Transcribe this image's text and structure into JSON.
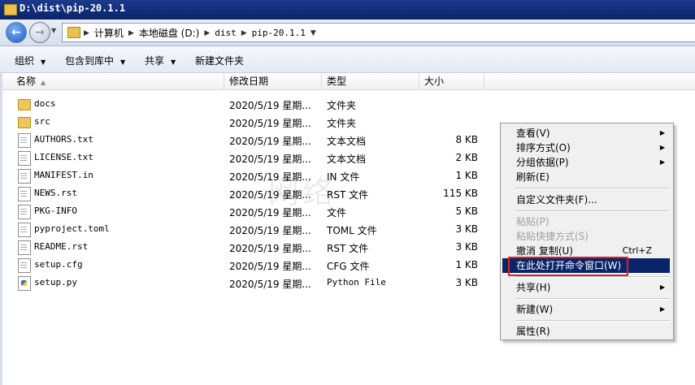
{
  "window": {
    "title": "D:\\dist\\pip-20.1.1"
  },
  "address": {
    "crumbs": [
      "计算机",
      "本地磁盘 (D:)",
      "dist",
      "pip-20.1.1"
    ]
  },
  "toolbar": {
    "organize": "组织",
    "include_library": "包含到库中",
    "share": "共享",
    "new_folder": "新建文件夹"
  },
  "columns": {
    "name": "名称",
    "date": "修改日期",
    "type": "类型",
    "size": "大小"
  },
  "files": [
    {
      "name": "docs",
      "date": "2020/5/19 星期...",
      "type": "文件夹",
      "size": "",
      "icon": "folder-icon"
    },
    {
      "name": "src",
      "date": "2020/5/19 星期...",
      "type": "文件夹",
      "size": "",
      "icon": "folder-icon"
    },
    {
      "name": "AUTHORS.txt",
      "date": "2020/5/19 星期...",
      "type": "文本文档",
      "size": "8 KB",
      "icon": "text-file-icon"
    },
    {
      "name": "LICENSE.txt",
      "date": "2020/5/19 星期...",
      "type": "文本文档",
      "size": "2 KB",
      "icon": "text-file-icon"
    },
    {
      "name": "MANIFEST.in",
      "date": "2020/5/19 星期...",
      "type": "IN 文件",
      "size": "1 KB",
      "icon": "file-icon"
    },
    {
      "name": "NEWS.rst",
      "date": "2020/5/19 星期...",
      "type": "RST 文件",
      "size": "115 KB",
      "icon": "file-icon"
    },
    {
      "name": "PKG-INFO",
      "date": "2020/5/19 星期...",
      "type": "文件",
      "size": "5 KB",
      "icon": "file-icon"
    },
    {
      "name": "pyproject.toml",
      "date": "2020/5/19 星期...",
      "type": "TOML 文件",
      "size": "3 KB",
      "icon": "file-icon"
    },
    {
      "name": "README.rst",
      "date": "2020/5/19 星期...",
      "type": "RST 文件",
      "size": "3 KB",
      "icon": "file-icon"
    },
    {
      "name": "setup.cfg",
      "date": "2020/5/19 星期...",
      "type": "CFG 文件",
      "size": "1 KB",
      "icon": "file-icon"
    },
    {
      "name": "setup.py",
      "date": "2020/5/19 星期...",
      "type": "Python File",
      "size": "3 KB",
      "icon": "python-file-icon"
    }
  ],
  "watermark": "网络",
  "context_menu": {
    "view": "查看(V)",
    "sort_by": "排序方式(O)",
    "group_by": "分组依据(P)",
    "refresh": "刷新(E)",
    "customize": "自定义文件夹(F)...",
    "paste": "粘贴(P)",
    "paste_shortcut": "粘贴快捷方式(S)",
    "undo_copy": "撤消 复制(U)",
    "undo_copy_shortcut": "Ctrl+Z",
    "open_cmd": "在此处打开命令窗口(W)",
    "share": "共享(H)",
    "new": "新建(W)",
    "properties": "属性(R)"
  },
  "colors": {
    "title_bar": "#0a246a",
    "menu_highlight": "#0a246a",
    "annotation_box": "#e02020",
    "folder": "#eec65a"
  }
}
